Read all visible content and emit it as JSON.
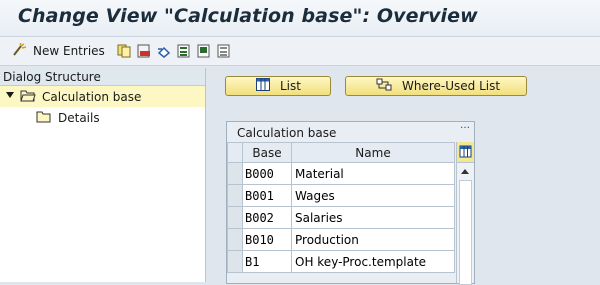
{
  "window": {
    "title": "Change View \"Calculation base\": Overview"
  },
  "toolbar": {
    "new_entries_label": "New Entries",
    "icons": [
      "new-entries-icon",
      "copy-icon",
      "delete-icon",
      "undo-icon",
      "select-all-icon",
      "select-block-icon",
      "deselect-all-icon"
    ]
  },
  "dialog_structure": {
    "header": "Dialog Structure",
    "items": [
      {
        "label": "Calculation base",
        "selected": true,
        "expanded": true
      },
      {
        "label": "Details",
        "selected": false
      }
    ]
  },
  "buttons": {
    "list_label": "List",
    "where_used_label": "Where-Used List"
  },
  "table": {
    "title": "Calculation base",
    "columns": [
      "Base",
      "Name"
    ],
    "rows": [
      {
        "base": "B000",
        "name": "Material"
      },
      {
        "base": "B001",
        "name": "Wages"
      },
      {
        "base": "B002",
        "name": "Salaries"
      },
      {
        "base": "B010",
        "name": "Production"
      },
      {
        "base": "B1",
        "name": "OH key-Proc.template"
      }
    ]
  },
  "colors": {
    "selected_tree_bg": "#fdf7c3",
    "button_yellow": "#f1df7c"
  }
}
